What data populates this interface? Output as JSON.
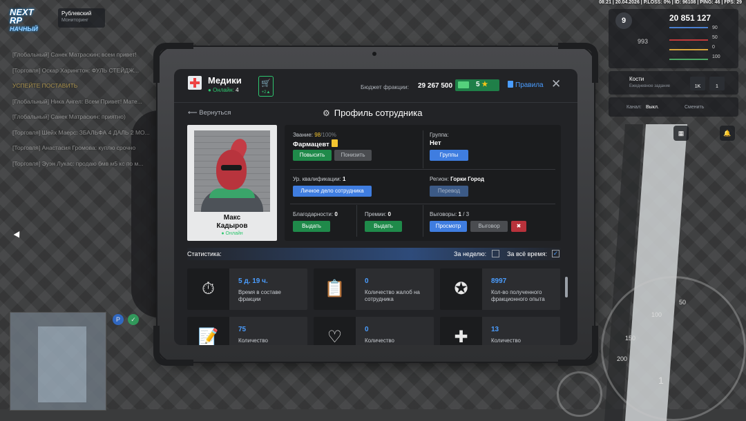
{
  "hud": {
    "top_status": "08:21 | 20.04.2026 | P.LOSS: 0% | ID: 96108 | PING: 46 | FPS: 29",
    "logo_line1": "NEXT RP",
    "logo_line2": "НАЧНЫЙ",
    "server_name": "Рублевский",
    "server_sub": "Мониторинг",
    "money": "20 851 127",
    "level": "9",
    "stat_90": "90",
    "stat_50": "50",
    "stat_0": "0",
    "stat_100": "100",
    "stat_993": "993",
    "task_title": "Кости",
    "task_sub": "Ежедневное задание",
    "task_chip1": "1K",
    "task_chip2": "1",
    "voice_label": "Канал:",
    "voice_value": "Выкл.",
    "voice_change": "Сменить",
    "speed_numbers": [
      "100",
      "150",
      "200",
      "50",
      "1"
    ]
  },
  "chat": [
    "[Глобальный] Санек Матраскин: всем привет!",
    "[Торговля] Оскар Харингтон: ФУЛЬ СТЕЙДЖ...",
    "УСПЕЙТЕ ПОСТАВИТЬ",
    "[Глобальный] Ника Ангел: Всем Привет! Мате...",
    "[Глобальный] Санек Матраскин: приятно)",
    "[Торговля] Шейх Маерс: ЗБАЛЬФА 4 ДАЛЬ 2 МО...",
    "[Торговля] Анастасия Громова: куплю срочно",
    "[Торговля] Эуэн Лукас: продаю бмв м5 кс по м..."
  ],
  "header": {
    "faction_name": "Медики",
    "online_label": "Онлайн:",
    "online_count": "4",
    "cart_icon": "cart-icon",
    "cart_badge": "+2▲",
    "budget_label": "Бюджет фракции:",
    "budget_value": "29 267 500",
    "stars_value": "5",
    "rules_label": "Правила",
    "close_glyph": "✕"
  },
  "nav": {
    "back_label": "Вернуться",
    "page_title": "Профиль сотрудника"
  },
  "employee": {
    "first_name": "Макс",
    "last_name": "Кадыров",
    "status": "Онлайн"
  },
  "profile": {
    "rank_label": "Звание:",
    "rank_points": "98",
    "rank_max": "/100%",
    "rank_name": "Фармацевт",
    "promote_btn": "Повысить",
    "demote_btn": "Понизить",
    "group_label": "Группа:",
    "group_value": "Нет",
    "groups_btn": "Группы",
    "qual_label": "Ур. квалификации:",
    "qual_value": "1",
    "personal_file_btn": "Личное дело сотрудника",
    "region_label": "Регион:",
    "region_value": "Горки Город",
    "transfer_btn": "Перевод",
    "thanks_label": "Благодарности:",
    "thanks_value": "0",
    "thanks_btn": "Выдать",
    "bonus_label": "Премии:",
    "bonus_value": "0",
    "bonus_btn": "Выдать",
    "reprimand_label": "Выговоры:",
    "reprimand_value": "1",
    "reprimand_max": "/ 3",
    "view_btn": "Просмотр",
    "reprimand_btn": "Выговор"
  },
  "stats": {
    "title": "Статистика:",
    "week_label": "За неделю:",
    "alltime_label": "За всё время:",
    "week_checked": false,
    "alltime_checked": true,
    "cards": [
      {
        "icon": "stopwatch-icon",
        "value": "5 д. 19 ч.",
        "desc": "Время в составе фракции"
      },
      {
        "icon": "complaint-icon",
        "value": "0",
        "desc": "Количество жалоб на сотрудника"
      },
      {
        "icon": "experience-badge-icon",
        "value": "8997",
        "desc": "Кол-во полученного фракционного опыта"
      },
      {
        "icon": "clipboard-icon",
        "value": "75",
        "desc": "Количество"
      },
      {
        "icon": "heartbeat-icon",
        "value": "0",
        "desc": "Количество"
      },
      {
        "icon": "medkit-icon",
        "value": "13",
        "desc": "Количество"
      }
    ]
  },
  "colors": {
    "accent_blue": "#3f7de0",
    "accent_green": "#1f8a4a",
    "online_green": "#2ec76f",
    "value_blue": "#4a9dff"
  }
}
